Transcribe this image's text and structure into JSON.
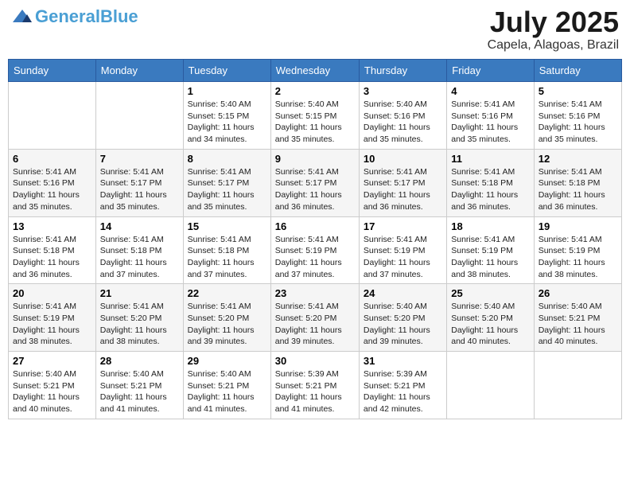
{
  "header": {
    "logo_text_main": "General",
    "logo_text_accent": "Blue",
    "month_year": "July 2025",
    "location": "Capela, Alagoas, Brazil"
  },
  "weekdays": [
    "Sunday",
    "Monday",
    "Tuesday",
    "Wednesday",
    "Thursday",
    "Friday",
    "Saturday"
  ],
  "weeks": [
    [
      {
        "day": "",
        "sunrise": "",
        "sunset": "",
        "daylight": ""
      },
      {
        "day": "",
        "sunrise": "",
        "sunset": "",
        "daylight": ""
      },
      {
        "day": "1",
        "sunrise": "Sunrise: 5:40 AM",
        "sunset": "Sunset: 5:15 PM",
        "daylight": "Daylight: 11 hours and 34 minutes."
      },
      {
        "day": "2",
        "sunrise": "Sunrise: 5:40 AM",
        "sunset": "Sunset: 5:15 PM",
        "daylight": "Daylight: 11 hours and 35 minutes."
      },
      {
        "day": "3",
        "sunrise": "Sunrise: 5:40 AM",
        "sunset": "Sunset: 5:16 PM",
        "daylight": "Daylight: 11 hours and 35 minutes."
      },
      {
        "day": "4",
        "sunrise": "Sunrise: 5:41 AM",
        "sunset": "Sunset: 5:16 PM",
        "daylight": "Daylight: 11 hours and 35 minutes."
      },
      {
        "day": "5",
        "sunrise": "Sunrise: 5:41 AM",
        "sunset": "Sunset: 5:16 PM",
        "daylight": "Daylight: 11 hours and 35 minutes."
      }
    ],
    [
      {
        "day": "6",
        "sunrise": "Sunrise: 5:41 AM",
        "sunset": "Sunset: 5:16 PM",
        "daylight": "Daylight: 11 hours and 35 minutes."
      },
      {
        "day": "7",
        "sunrise": "Sunrise: 5:41 AM",
        "sunset": "Sunset: 5:17 PM",
        "daylight": "Daylight: 11 hours and 35 minutes."
      },
      {
        "day": "8",
        "sunrise": "Sunrise: 5:41 AM",
        "sunset": "Sunset: 5:17 PM",
        "daylight": "Daylight: 11 hours and 35 minutes."
      },
      {
        "day": "9",
        "sunrise": "Sunrise: 5:41 AM",
        "sunset": "Sunset: 5:17 PM",
        "daylight": "Daylight: 11 hours and 36 minutes."
      },
      {
        "day": "10",
        "sunrise": "Sunrise: 5:41 AM",
        "sunset": "Sunset: 5:17 PM",
        "daylight": "Daylight: 11 hours and 36 minutes."
      },
      {
        "day": "11",
        "sunrise": "Sunrise: 5:41 AM",
        "sunset": "Sunset: 5:18 PM",
        "daylight": "Daylight: 11 hours and 36 minutes."
      },
      {
        "day": "12",
        "sunrise": "Sunrise: 5:41 AM",
        "sunset": "Sunset: 5:18 PM",
        "daylight": "Daylight: 11 hours and 36 minutes."
      }
    ],
    [
      {
        "day": "13",
        "sunrise": "Sunrise: 5:41 AM",
        "sunset": "Sunset: 5:18 PM",
        "daylight": "Daylight: 11 hours and 36 minutes."
      },
      {
        "day": "14",
        "sunrise": "Sunrise: 5:41 AM",
        "sunset": "Sunset: 5:18 PM",
        "daylight": "Daylight: 11 hours and 37 minutes."
      },
      {
        "day": "15",
        "sunrise": "Sunrise: 5:41 AM",
        "sunset": "Sunset: 5:18 PM",
        "daylight": "Daylight: 11 hours and 37 minutes."
      },
      {
        "day": "16",
        "sunrise": "Sunrise: 5:41 AM",
        "sunset": "Sunset: 5:19 PM",
        "daylight": "Daylight: 11 hours and 37 minutes."
      },
      {
        "day": "17",
        "sunrise": "Sunrise: 5:41 AM",
        "sunset": "Sunset: 5:19 PM",
        "daylight": "Daylight: 11 hours and 37 minutes."
      },
      {
        "day": "18",
        "sunrise": "Sunrise: 5:41 AM",
        "sunset": "Sunset: 5:19 PM",
        "daylight": "Daylight: 11 hours and 38 minutes."
      },
      {
        "day": "19",
        "sunrise": "Sunrise: 5:41 AM",
        "sunset": "Sunset: 5:19 PM",
        "daylight": "Daylight: 11 hours and 38 minutes."
      }
    ],
    [
      {
        "day": "20",
        "sunrise": "Sunrise: 5:41 AM",
        "sunset": "Sunset: 5:19 PM",
        "daylight": "Daylight: 11 hours and 38 minutes."
      },
      {
        "day": "21",
        "sunrise": "Sunrise: 5:41 AM",
        "sunset": "Sunset: 5:20 PM",
        "daylight": "Daylight: 11 hours and 38 minutes."
      },
      {
        "day": "22",
        "sunrise": "Sunrise: 5:41 AM",
        "sunset": "Sunset: 5:20 PM",
        "daylight": "Daylight: 11 hours and 39 minutes."
      },
      {
        "day": "23",
        "sunrise": "Sunrise: 5:41 AM",
        "sunset": "Sunset: 5:20 PM",
        "daylight": "Daylight: 11 hours and 39 minutes."
      },
      {
        "day": "24",
        "sunrise": "Sunrise: 5:40 AM",
        "sunset": "Sunset: 5:20 PM",
        "daylight": "Daylight: 11 hours and 39 minutes."
      },
      {
        "day": "25",
        "sunrise": "Sunrise: 5:40 AM",
        "sunset": "Sunset: 5:20 PM",
        "daylight": "Daylight: 11 hours and 40 minutes."
      },
      {
        "day": "26",
        "sunrise": "Sunrise: 5:40 AM",
        "sunset": "Sunset: 5:21 PM",
        "daylight": "Daylight: 11 hours and 40 minutes."
      }
    ],
    [
      {
        "day": "27",
        "sunrise": "Sunrise: 5:40 AM",
        "sunset": "Sunset: 5:21 PM",
        "daylight": "Daylight: 11 hours and 40 minutes."
      },
      {
        "day": "28",
        "sunrise": "Sunrise: 5:40 AM",
        "sunset": "Sunset: 5:21 PM",
        "daylight": "Daylight: 11 hours and 41 minutes."
      },
      {
        "day": "29",
        "sunrise": "Sunrise: 5:40 AM",
        "sunset": "Sunset: 5:21 PM",
        "daylight": "Daylight: 11 hours and 41 minutes."
      },
      {
        "day": "30",
        "sunrise": "Sunrise: 5:39 AM",
        "sunset": "Sunset: 5:21 PM",
        "daylight": "Daylight: 11 hours and 41 minutes."
      },
      {
        "day": "31",
        "sunrise": "Sunrise: 5:39 AM",
        "sunset": "Sunset: 5:21 PM",
        "daylight": "Daylight: 11 hours and 42 minutes."
      },
      {
        "day": "",
        "sunrise": "",
        "sunset": "",
        "daylight": ""
      },
      {
        "day": "",
        "sunrise": "",
        "sunset": "",
        "daylight": ""
      }
    ]
  ]
}
